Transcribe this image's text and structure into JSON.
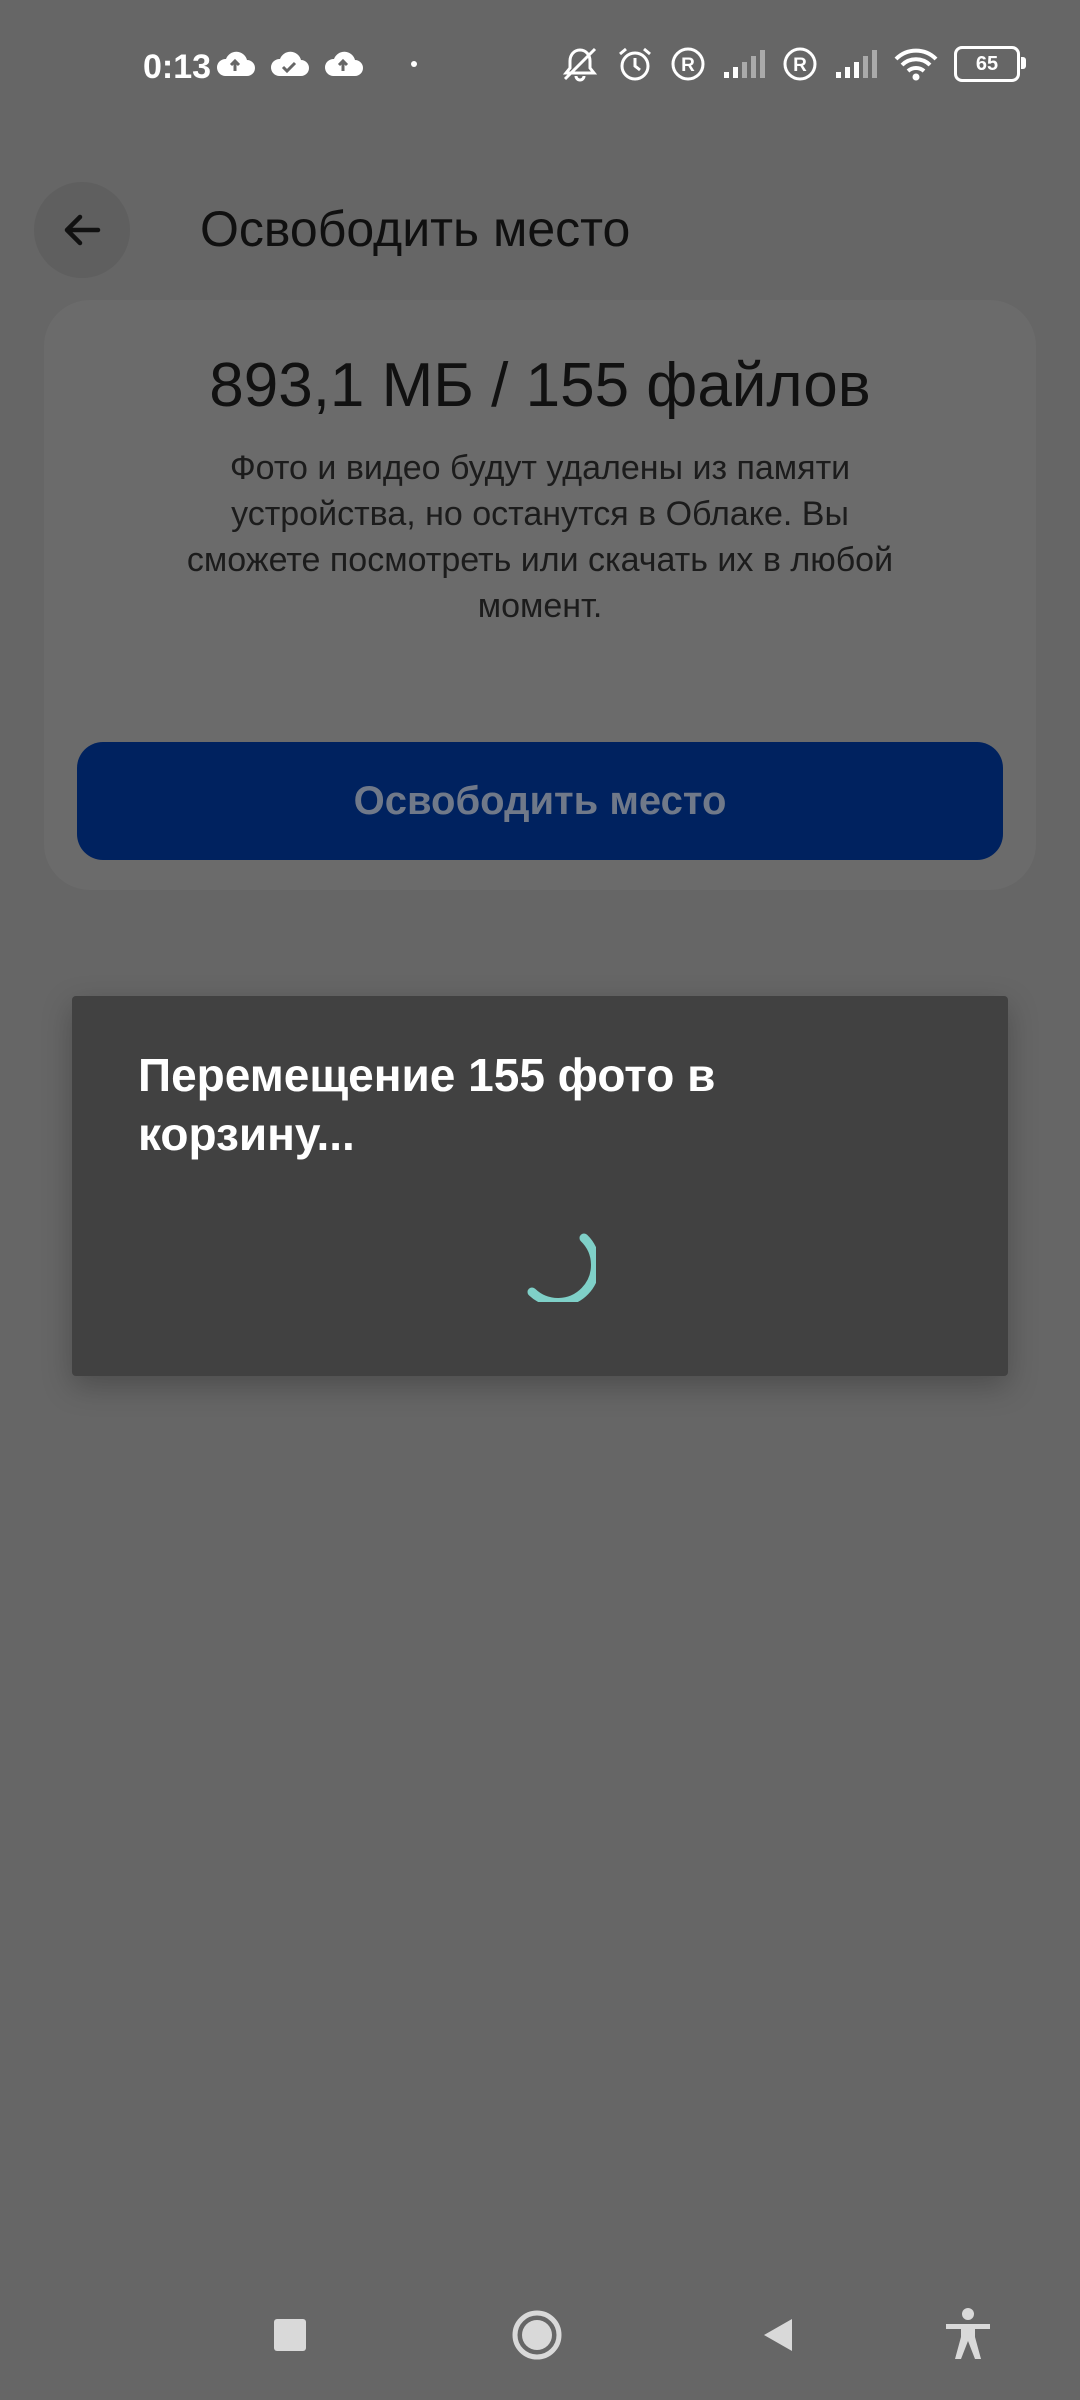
{
  "status_bar": {
    "time": "0:13",
    "battery_level": "65",
    "left_icons": [
      "cloud-upload-icon",
      "cloud-check-icon",
      "cloud-upload-icon"
    ],
    "right_icons": [
      "bell-off-icon",
      "alarm-icon",
      "roaming-r-icon",
      "signal-icon",
      "roaming-r-icon",
      "signal-icon",
      "wifi-icon",
      "battery-icon"
    ]
  },
  "header": {
    "title": "Освободить место",
    "back_icon": "arrow-left-icon"
  },
  "card": {
    "headline": "893,1 МБ / 155 файлов",
    "description": "Фото и видео будут удалены из памяти устройства, но останутся в Облаке. Вы сможете посмотреть или скачать их в любой момент.",
    "button_label": "Освободить место",
    "button_color": "#00225f"
  },
  "dialog": {
    "message": "Перемещение 155 фото в корзину...",
    "spinner_color": "#7fd0c8"
  },
  "navbar": {
    "items": [
      "recents-square-icon",
      "home-circle-icon",
      "back-triangle-icon",
      "accessibility-icon"
    ]
  }
}
